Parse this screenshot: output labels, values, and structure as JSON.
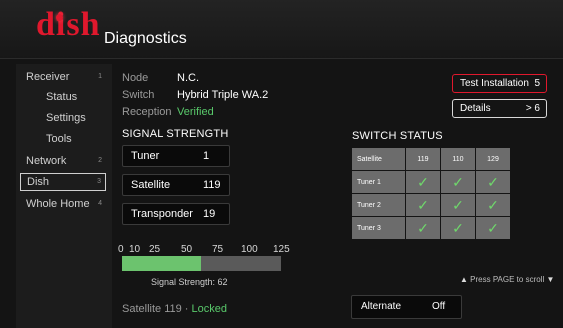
{
  "header": {
    "logo": "dish",
    "title": "Diagnostics"
  },
  "sidebar": {
    "items": [
      {
        "label": "Receiver",
        "num": "1"
      },
      {
        "label": "Status",
        "num": ""
      },
      {
        "label": "Settings",
        "num": ""
      },
      {
        "label": "Tools",
        "num": ""
      },
      {
        "label": "Network",
        "num": "2"
      },
      {
        "label": "Dish",
        "num": "3"
      },
      {
        "label": "Whole Home",
        "num": "4"
      }
    ]
  },
  "info": {
    "node_label": "Node",
    "node_value": "N.C.",
    "switch_label": "Switch",
    "switch_value": "Hybrid Triple WA.2",
    "reception_label": "Reception",
    "reception_value": "Verified"
  },
  "signal": {
    "heading": "SIGNAL STRENGTH",
    "tuner_label": "Tuner",
    "tuner_value": "1",
    "satellite_label": "Satellite",
    "satellite_value": "119",
    "transponder_label": "Transponder",
    "transponder_value": "19",
    "scale": [
      "0",
      "10",
      "25",
      "50",
      "75",
      "100",
      "125"
    ],
    "strength_value": 62,
    "strength_max": 125,
    "strength_text": "Signal Strength: 62",
    "lock_prefix": "Satellite 119 · ",
    "lock_status": "Locked"
  },
  "buttons": {
    "test_label": "Test Installation",
    "test_key": "5",
    "details_label": "Details",
    "details_key": "> 6"
  },
  "switch_status": {
    "heading": "SWITCH STATUS",
    "corner": "Satellite",
    "columns": [
      "119",
      "110",
      "129"
    ],
    "rows": [
      "Tuner 1",
      "Tuner 2",
      "Tuner 3"
    ],
    "check": "✓"
  },
  "scroll_hint": {
    "up": "▲",
    "text": " Press PAGE to scroll ",
    "down": "▼"
  },
  "alternate": {
    "label": "Alternate",
    "value": "Off"
  },
  "colors": {
    "brand": "#e0182d",
    "ok": "#59c96b",
    "bar_fill": "#6cc36e"
  }
}
